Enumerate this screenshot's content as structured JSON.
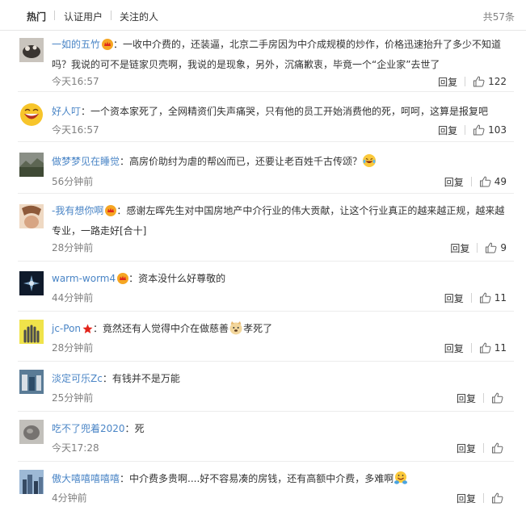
{
  "tabs": {
    "hot": "热门",
    "verified": "认证用户",
    "following": "关注的人",
    "total": "共57条"
  },
  "labels": {
    "reply": "回复",
    "colon": "："
  },
  "comments": [
    {
      "user": "一如的五竹",
      "badge": "crown",
      "text_lines": [
        "一收中介费的，还装逼，北京二手房因为中介成规模的炒作，价格迅速抬升了多少不知道",
        "吗？我说的可不是链家贝壳啊，我说的是现象，另外，沉痛歉衷，毕竟一个“企业家”去世了"
      ],
      "time": "今天16:57",
      "likes": "122"
    },
    {
      "user": "好人叮",
      "badge": "",
      "text_lines": [
        "一个资本家死了，全网精资们失声痛哭，只有他的员工开始消费他的死，呵呵，这算是报复吧"
      ],
      "time": "今天16:57",
      "likes": "103"
    },
    {
      "user": "做梦梦见在睡觉",
      "badge": "",
      "text_lines": [
        "高房价助纣为虐的帮凶而已，还要让老百姓千古传颂？"
      ],
      "time": "56分钟前",
      "likes": "49"
    },
    {
      "user": "-我有想你啊",
      "badge": "crown",
      "text_lines": [
        "感谢左晖先生对中国房地产中介行业的伟大贡献，让这个行业真正的越来越正规，越来越",
        "专业，一路走好[合十]"
      ],
      "time": "28分钟前",
      "likes": "9"
    },
    {
      "user": "warm-worm4",
      "badge": "crown",
      "text_lines": [
        "资本没什么好尊敬的"
      ],
      "time": "44分钟前",
      "likes": "11"
    },
    {
      "user": "jc-Pon",
      "badge": "star",
      "text_lines": [
        "竟然还有人觉得中介在做慈善",
        "孝死了"
      ],
      "time": "28分钟前",
      "likes": "11"
    },
    {
      "user": "淡定可乐Zc",
      "badge": "",
      "text_lines": [
        "有钱并不是万能"
      ],
      "time": "25分钟前",
      "likes": ""
    },
    {
      "user": "吃不了兜着2020",
      "badge": "",
      "text_lines": [
        "死"
      ],
      "time": "今天17:28",
      "likes": ""
    },
    {
      "user": "傲大嘻嘻嘻嘻嘻",
      "badge": "",
      "text_lines": [
        "中介费多贵啊....好不容易凑的房钱，还有高额中介费，多难啊"
      ],
      "time": "4分钟前",
      "likes": ""
    }
  ]
}
